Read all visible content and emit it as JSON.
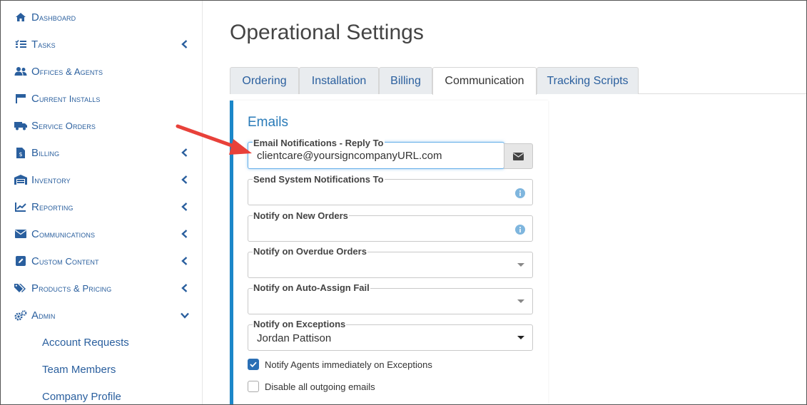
{
  "sidebar": {
    "items": [
      {
        "label": "Dashboard",
        "icon": "home-icon",
        "expandable": false
      },
      {
        "label": "Tasks",
        "icon": "tasks-icon",
        "expandable": true,
        "state": "collapsed"
      },
      {
        "label": "Offices & Agents",
        "icon": "users-icon",
        "expandable": false
      },
      {
        "label": "Current Installs",
        "icon": "flag-icon",
        "expandable": false
      },
      {
        "label": "Service Orders",
        "icon": "truck-icon",
        "expandable": false
      },
      {
        "label": "Billing",
        "icon": "invoice-icon",
        "expandable": true,
        "state": "collapsed"
      },
      {
        "label": "Inventory",
        "icon": "warehouse-icon",
        "expandable": true,
        "state": "collapsed"
      },
      {
        "label": "Reporting",
        "icon": "chart-line-icon",
        "expandable": true,
        "state": "collapsed"
      },
      {
        "label": "Communications",
        "icon": "envelope-icon",
        "expandable": true,
        "state": "collapsed"
      },
      {
        "label": "Custom Content",
        "icon": "edit-icon",
        "expandable": true,
        "state": "collapsed"
      },
      {
        "label": "Products & Pricing",
        "icon": "tags-icon",
        "expandable": true,
        "state": "collapsed"
      },
      {
        "label": "Admin",
        "icon": "cogs-icon",
        "expandable": true,
        "state": "expanded"
      }
    ],
    "admin_subitems": [
      "Account Requests",
      "Team Members",
      "Company Profile"
    ]
  },
  "page": {
    "title": "Operational Settings"
  },
  "tabs": [
    {
      "label": "Ordering",
      "active": false
    },
    {
      "label": "Installation",
      "active": false
    },
    {
      "label": "Billing",
      "active": false
    },
    {
      "label": "Communication",
      "active": true
    },
    {
      "label": "Tracking Scripts",
      "active": false
    }
  ],
  "emails": {
    "section_title": "Emails",
    "reply_to": {
      "label": "Email Notifications - Reply To",
      "value": "clientcare@yoursigncompanyURL.com"
    },
    "system_notifications": {
      "label": "Send System Notifications To",
      "value": ""
    },
    "new_orders": {
      "label": "Notify on New Orders",
      "value": ""
    },
    "overdue_orders": {
      "label": "Notify on Overdue Orders",
      "value": ""
    },
    "auto_assign_fail": {
      "label": "Notify on Auto-Assign Fail",
      "value": ""
    },
    "exceptions": {
      "label": "Notify on Exceptions",
      "value": "Jordan Pattison"
    },
    "notify_agents": {
      "label": "Notify Agents immediately on Exceptions",
      "checked": true
    },
    "disable_outgoing": {
      "label": "Disable all outgoing emails",
      "checked": false
    }
  },
  "colors": {
    "link": "#2a5f9e",
    "accent": "#1b87c9",
    "annotation_arrow": "#e8413a",
    "checkbox_checked": "#2a6fb5"
  }
}
